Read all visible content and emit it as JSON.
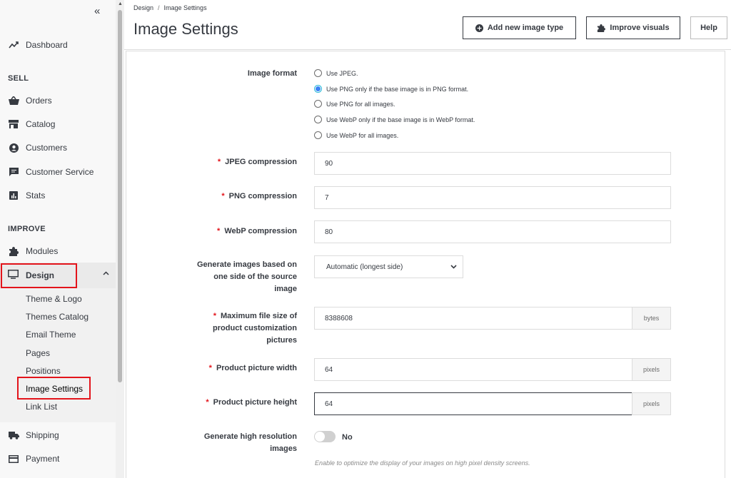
{
  "sidebar": {
    "collapse_label": "«",
    "dashboard": "Dashboard",
    "section_sell": "SELL",
    "orders": "Orders",
    "catalog": "Catalog",
    "customers": "Customers",
    "customer_service": "Customer Service",
    "stats": "Stats",
    "section_improve": "IMPROVE",
    "modules": "Modules",
    "design": "Design",
    "design_submenu": [
      "Theme & Logo",
      "Themes Catalog",
      "Email Theme",
      "Pages",
      "Positions",
      "Image Settings",
      "Link List"
    ],
    "shipping": "Shipping",
    "payment": "Payment"
  },
  "breadcrumb": {
    "parent": "Design",
    "sep": "/",
    "current": "Image Settings"
  },
  "page_title": "Image Settings",
  "toolbar": {
    "add_image_type": "Add new image type",
    "improve_visuals": "Improve visuals",
    "help": "Help"
  },
  "form": {
    "image_format": {
      "label": "Image format",
      "options": [
        "Use JPEG.",
        "Use PNG only if the base image is in PNG format.",
        "Use PNG for all images.",
        "Use WebP only if the base image is in WebP format.",
        "Use WebP for all images."
      ],
      "selected": "Use PNG only if the base image is in PNG format."
    },
    "jpeg_compression": {
      "required": "*",
      "label": "JPEG compression",
      "value": "90"
    },
    "png_compression": {
      "required": "*",
      "label": "PNG compression",
      "value": "7"
    },
    "webp_compression": {
      "required": "*",
      "label": "WebP compression",
      "value": "80"
    },
    "generate_side": {
      "label_lines": [
        "Generate images based on",
        "one side of the source",
        "image"
      ],
      "value": "Automatic (longest side)"
    },
    "max_file_size": {
      "required": "*",
      "label_lines": [
        "Maximum file size of",
        "product customization",
        "pictures"
      ],
      "value": "8388608",
      "unit": "bytes"
    },
    "picture_width": {
      "required": "*",
      "label": "Product picture width",
      "value": "64",
      "unit": "pixels"
    },
    "picture_height": {
      "required": "*",
      "label": "Product picture height",
      "value": "64",
      "unit": "pixels"
    },
    "high_res": {
      "label_lines": [
        "Generate high resolution",
        "images"
      ],
      "state": "No",
      "help": "Enable to optimize the display of your images on high pixel density screens."
    }
  }
}
